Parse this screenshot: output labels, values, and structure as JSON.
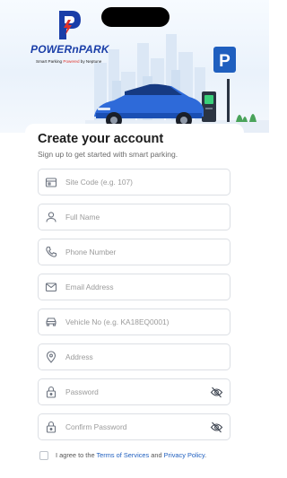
{
  "brand": {
    "name": "POWERnPARK",
    "tagline_prefix": "Smart Parking ",
    "tagline_highlight": "Powered",
    "tagline_suffix": " by Neptune",
    "primary_color": "#1a3ea8",
    "accent_color": "#e0322a"
  },
  "parking_sign": {
    "letter": "P"
  },
  "form": {
    "title": "Create your account",
    "subtitle": "Sign up to get started with smart parking.",
    "fields": [
      {
        "icon": "building-icon",
        "placeholder": "Site Code (e.g. 107)",
        "value": ""
      },
      {
        "icon": "person-icon",
        "placeholder": "Full Name",
        "value": ""
      },
      {
        "icon": "phone-icon",
        "placeholder": "Phone Number",
        "value": ""
      },
      {
        "icon": "mail-icon",
        "placeholder": "Email Address",
        "value": ""
      },
      {
        "icon": "car-icon",
        "placeholder": "Vehicle No (e.g. KA18EQ0001)",
        "value": ""
      },
      {
        "icon": "location-pin-icon",
        "placeholder": "Address",
        "value": ""
      },
      {
        "icon": "lock-icon",
        "placeholder": "Password",
        "value": "",
        "toggle_icon": "eye-off-icon"
      },
      {
        "icon": "lock-icon",
        "placeholder": "Confirm Password",
        "value": "",
        "toggle_icon": "eye-off-icon"
      }
    ],
    "agree": {
      "prefix": "I agree to the ",
      "terms": "Terms of Services",
      "middle": " and ",
      "privacy": "Privacy Policy",
      "suffix": ".",
      "checked": false
    },
    "link_color": "#1f5fbf"
  }
}
